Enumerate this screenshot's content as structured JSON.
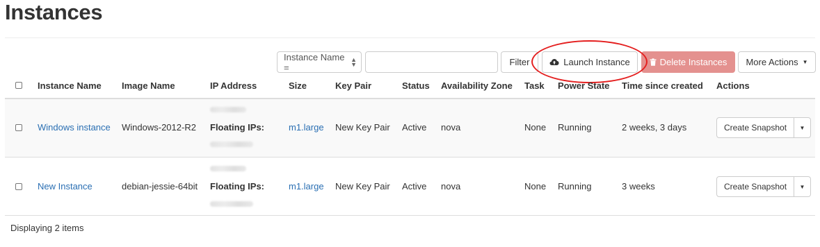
{
  "page": {
    "title": "Instances"
  },
  "toolbar": {
    "filter_field": "Instance Name =",
    "filter_value": "",
    "filter_label": "Filter",
    "launch_label": "Launch Instance",
    "delete_label": "Delete Instances",
    "more_label": "More Actions"
  },
  "table": {
    "headers": [
      "Instance Name",
      "Image Name",
      "IP Address",
      "Size",
      "Key Pair",
      "Status",
      "Availability Zone",
      "Task",
      "Power State",
      "Time since created",
      "Actions"
    ],
    "rows": [
      {
        "name": "Windows instance",
        "image": "Windows-2012-R2",
        "floating_label": "Floating IPs:",
        "size": "m1.large",
        "key_pair": "New Key Pair",
        "status": "Active",
        "zone": "nova",
        "task": "None",
        "power": "Running",
        "age": "2 weeks, 3 days",
        "action": "Create Snapshot"
      },
      {
        "name": "New Instance",
        "image": "debian-jessie-64bit",
        "floating_label": "Floating IPs:",
        "size": "m1.large",
        "key_pair": "New Key Pair",
        "status": "Active",
        "zone": "nova",
        "task": "None",
        "power": "Running",
        "age": "3 weeks",
        "action": "Create Snapshot"
      }
    ]
  },
  "footer": {
    "text": "Displaying 2 items"
  },
  "icons": {
    "launch": "cloud-upload-icon",
    "delete": "trash-icon",
    "more": "caret-down-icon",
    "select_arrows": "sort-arrows-icon"
  },
  "colors": {
    "link": "#2a6fb3",
    "delete_button": "#e4918f",
    "annotation_circle": "#e41e1e"
  }
}
